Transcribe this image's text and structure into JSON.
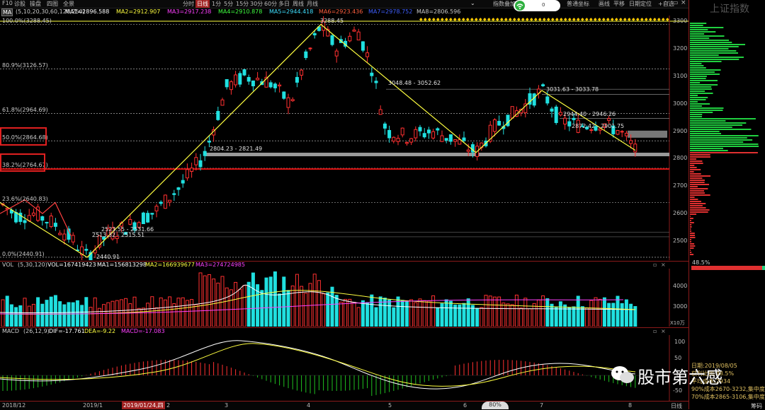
{
  "toolbar": {
    "left": [
      "F10",
      "诊股",
      "操盘",
      "四图",
      "全景"
    ],
    "periods": [
      "分时",
      "日线",
      "1分",
      "5分",
      "15分",
      "30分",
      "60分",
      "多日",
      "周线",
      "月线"
    ],
    "active_period": "日线",
    "right": [
      "指数叠加",
      "普通坐标",
      "画线",
      "平移",
      "日期定位",
      "+自选"
    ],
    "right_glyph_label": "0"
  },
  "ma_line": {
    "name": "MA",
    "params": "(5,10,20,30,60,120,250)",
    "items": [
      {
        "text": "MA1=2896.588",
        "color": "#ffffff"
      },
      {
        "text": "MA2=2912.907",
        "color": "#ffff40"
      },
      {
        "text": "MA3=2917.238",
        "color": "#ff40ff"
      },
      {
        "text": "MA4=2910.878",
        "color": "#40ff40"
      },
      {
        "text": "MA5=2944.418",
        "color": "#40e0ff"
      },
      {
        "text": "MA6=2923.436",
        "color": "#ff6040"
      },
      {
        "text": "MA7=2978.752",
        "color": "#4060ff"
      },
      {
        "text": "MA8=2806.596",
        "color": "#cccccc"
      }
    ]
  },
  "vol_line": {
    "name": "VOL",
    "params": "(5,30,120)",
    "items": [
      {
        "text": "VOL=167419423",
        "color": "#ffffff"
      },
      {
        "text": "MA1=156813298",
        "color": "#ffffff"
      },
      {
        "text": "MA2=166939677",
        "color": "#ffff40"
      },
      {
        "text": "MA3=274724985",
        "color": "#ff40ff"
      }
    ]
  },
  "macd_line": {
    "name": "MACD",
    "params": "(26,12,9)",
    "items": [
      {
        "text": "DIF=-17.761",
        "color": "#ffffff"
      },
      {
        "text": "DEA=-9.22",
        "color": "#ffff40"
      },
      {
        "text": "MACD=-17.083",
        "color": "#ff40ff"
      }
    ]
  },
  "price_axis": [
    "3300",
    "3200",
    "3100",
    "3000",
    "2900",
    "2800",
    "2700",
    "2600",
    "2500"
  ],
  "vol_axis": [
    "4000",
    "3000"
  ],
  "vol_unit": "X10万",
  "macd_axis": [
    "100",
    "50",
    "0",
    "-50"
  ],
  "fibonacci": [
    {
      "label": "100.0%(3288.45)",
      "y": 3288.45
    },
    {
      "label": "80.9%(3126.57)",
      "y": 3126.57
    },
    {
      "label": "61.8%(2964.69)",
      "y": 2964.69
    },
    {
      "label": "50.0%(2864.68)",
      "y": 2864.68
    },
    {
      "label": "38.2%(2764.67)",
      "y": 2764.67
    },
    {
      "label": "23.6%(2640.83)",
      "y": 2640.83
    },
    {
      "label": "0.0%(2440.91)",
      "y": 2440.91
    }
  ],
  "annotations": {
    "high": "3288.45",
    "low": "2440.91",
    "r1": "3048.48 - 3052.62",
    "r2": "3031.63 - 3033.78",
    "r3": "2944.40 - 2946.26",
    "r4": "2872.42 - 2901.75",
    "s1": "2804.23 - 2821.49",
    "s2": "2523.55 - 2531.66",
    "s3": "2513.32 - 2515.51"
  },
  "dates": [
    "2018/12",
    "2019/1",
    "2019/01/24,四",
    "2",
    "3",
    "4",
    "5",
    "6",
    "7",
    "8"
  ],
  "right_panel": {
    "title": "上证指数",
    "profit_pct": "48.5%",
    "cost_lines": [
      "日期:2019/08/05",
      "获利比例:48.5%",
      "平均成本:2934",
      "90%成本2670-3232,集中度9.5",
      "70%成本2865-3106,集中度4.5"
    ],
    "bottom_label": "筹码",
    "bottom_right": "日线"
  },
  "watermark": "股市第六感",
  "bottom_badge": "80%",
  "colors": {
    "up": "#ff3030",
    "down": "#20e0e0",
    "wave": "#ffff40",
    "frame": "#8a1a1a",
    "fibo": "#cccccc",
    "support_band": "#9a9a9a",
    "key_line": "#e01010"
  },
  "chart_data": {
    "type": "candlestick",
    "title": "上证指数",
    "ylim": [
      2420,
      3310
    ],
    "wave_points": [
      {
        "date": "2019/01/04",
        "price": 2440.91
      },
      {
        "date": "2019/04/08",
        "price": 3288.45
      },
      {
        "date": "2019/06/06",
        "price": 2822
      },
      {
        "date": "2019/07/02",
        "price": 3048
      },
      {
        "date": "2019/08/05",
        "price": 2830
      }
    ]
  }
}
